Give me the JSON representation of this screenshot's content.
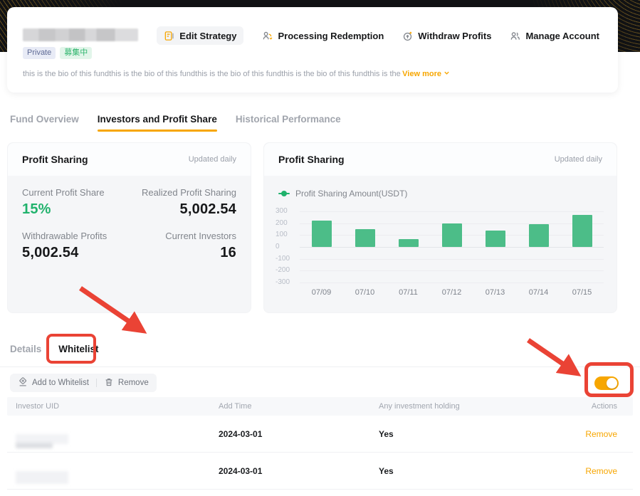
{
  "colors": {
    "accent_orange": "#f7a600",
    "positive_green": "#20b26c",
    "bar_green": "#4cbd88",
    "annotation_red": "#ea4335",
    "banner_black": "#111214",
    "banner_gold": "#b08426"
  },
  "header": {
    "fund_name_redacted": true,
    "badges": [
      {
        "label": "Private"
      },
      {
        "label": "募集中"
      }
    ],
    "bio": "this is the bio of this fundthis is the bio of this fundthis is the bio of this fundthis is the bio of this fundthis is the bio of this fundthis is the",
    "view_more_label": "View more",
    "actions": [
      {
        "label": "Edit Strategy",
        "icon": "edit-strategy-icon"
      },
      {
        "label": "Processing Redemption",
        "icon": "processing-redemption-icon"
      },
      {
        "label": "Withdraw Profits",
        "icon": "withdraw-profits-icon"
      },
      {
        "label": "Manage Account",
        "icon": "manage-account-icon"
      }
    ]
  },
  "main_tabs": [
    {
      "label": "Fund Overview",
      "active": false
    },
    {
      "label": "Investors and Profit Share",
      "active": true
    },
    {
      "label": "Historical Performance",
      "active": false
    }
  ],
  "stats_card": {
    "title": "Profit Sharing",
    "updated_label": "Updated daily",
    "stats": [
      {
        "label": "Current Profit Share",
        "value": "15%"
      },
      {
        "label": "Realized Profit Sharing",
        "value": "5,002.54"
      },
      {
        "label": "Withdrawable Profits",
        "value": "5,002.54"
      },
      {
        "label": "Current Investors",
        "value": "16"
      }
    ]
  },
  "chart_card": {
    "title": "Profit Sharing",
    "updated_label": "Updated daily",
    "legend": "Profit Sharing Amount(USDT)"
  },
  "chart_data": {
    "type": "bar",
    "title": "Profit Sharing",
    "series_name": "Profit Sharing Amount(USDT)",
    "categories": [
      "07/09",
      "07/10",
      "07/11",
      "07/12",
      "07/13",
      "07/14",
      "07/15"
    ],
    "values": [
      220,
      150,
      65,
      200,
      140,
      190,
      270
    ],
    "ylim": [
      -300,
      300
    ],
    "yticks": [
      300,
      200,
      100,
      0,
      -100,
      -200,
      -300
    ],
    "grid": true,
    "legend_position": "top-left",
    "bar_color": "#4cbd88"
  },
  "whitelist": {
    "tabs": [
      {
        "label": "Details",
        "active": false
      },
      {
        "label": "Whitelist",
        "active": true
      }
    ],
    "toolbar": {
      "add_label": "Add to Whitelist",
      "remove_label": "Remove"
    },
    "toggle_on": true,
    "table": {
      "columns": [
        "Investor UID",
        "Add Time",
        "Any investment holding",
        "Actions"
      ],
      "rows": [
        {
          "uid_redacted": true,
          "add_time": "2024-03-01",
          "holding": "Yes",
          "action_label": "Remove"
        },
        {
          "uid_redacted": true,
          "add_time": "2024-03-01",
          "holding": "Yes",
          "action_label": "Remove"
        }
      ]
    }
  }
}
